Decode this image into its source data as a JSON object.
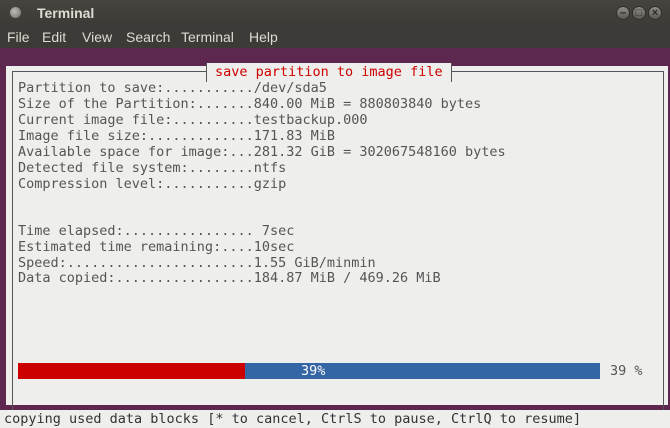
{
  "window": {
    "title": "Terminal"
  },
  "window_buttons": {
    "minimize": "–",
    "maximize": "□",
    "close": "×"
  },
  "menu": {
    "items": [
      "File",
      "Edit",
      "View",
      "Search",
      "Terminal",
      "Help"
    ]
  },
  "dialog": {
    "title": "save partition to image file"
  },
  "info_lines": [
    "Partition to save:...........",
    "/dev/sda5",
    "Size of the Partition:.......",
    "840.00 MiB = 880803840 bytes",
    "Current image file:..........",
    "testbackup.000",
    "Image file size:.............",
    "171.83 MiB",
    "Available space for image:...",
    "281.32 GiB = 302067548160 bytes",
    "Detected file system:........",
    "ntfs",
    "Compression level:...........",
    "gzip"
  ],
  "stats": [
    {
      "label": "Time elapsed:................",
      "value": " 7sec"
    },
    {
      "label": "Estimated time remaining:....",
      "value": "10sec"
    },
    {
      "label": "Speed:.......................",
      "value": "1.55 GiB/minmin"
    },
    {
      "label": "Data copied:.................",
      "value": "184.87 MiB / 469.26 MiB"
    }
  ],
  "progress": {
    "value": 0.39,
    "label": "39%",
    "percent_text": "39 %",
    "fill_color": "#cc0000",
    "track_color": "#3465a4"
  },
  "status": {
    "text": "copying used data blocks [* to cancel, CtrlS to pause, CtrlQ to resume]"
  },
  "colors": {
    "terminal_bg": "#5e2750",
    "dialog_bg": "#eeeeec",
    "title_red": "#cc0000",
    "text_gray": "#555555"
  },
  "icons": {
    "app": "terminal-icon"
  }
}
